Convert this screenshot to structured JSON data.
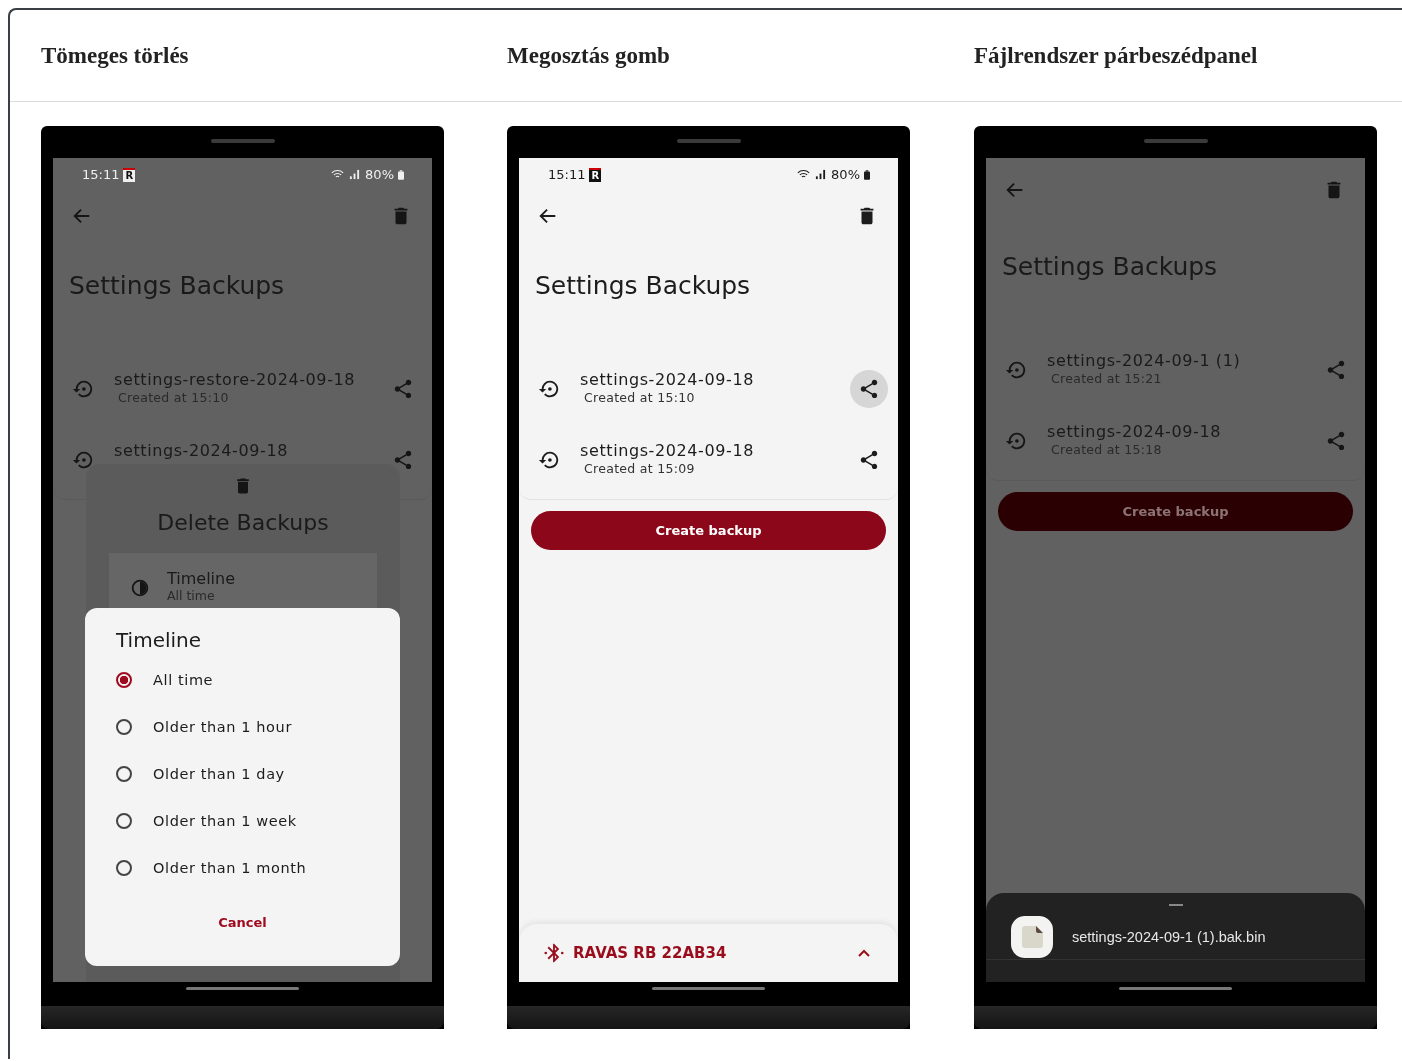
{
  "panels": [
    {
      "heading": "Tömeges törlés",
      "phone": {
        "dimmed": true,
        "status_bar": {
          "time": "15:11",
          "app_badge": "R",
          "battery": "80%"
        },
        "title": "Settings Backups",
        "backups": [
          {
            "name": "settings-restore-2024-09-18",
            "created": "Created at 15:10",
            "share_pressed": false
          },
          {
            "name": "settings-2024-09-18",
            "share_pressed": false
          }
        ],
        "delete_sheet": {
          "title": "Delete Backups",
          "option_label": "Timeline",
          "option_value": "All time"
        },
        "timeline_dialog": {
          "title": "Timeline",
          "options": [
            {
              "label": "All time",
              "selected": true
            },
            {
              "label": "Older than 1 hour",
              "selected": false
            },
            {
              "label": "Older than 1 day",
              "selected": false
            },
            {
              "label": "Older than 1 week",
              "selected": false
            },
            {
              "label": "Older than 1 month",
              "selected": false
            }
          ],
          "cancel": "Cancel"
        }
      }
    },
    {
      "heading": "Megosztás gomb",
      "phone": {
        "dimmed": false,
        "status_bar": {
          "time": "15:11",
          "app_badge": "R",
          "battery": "80%"
        },
        "title": "Settings Backups",
        "backups": [
          {
            "name": "settings-2024-09-18",
            "created": "Created at 15:10",
            "share_pressed": true
          },
          {
            "name": "settings-2024-09-18",
            "created": "Created at 15:09",
            "share_pressed": false
          }
        ],
        "create_button": "Create backup",
        "device_bar": {
          "name": "RAVAS RB 22AB34"
        }
      }
    },
    {
      "heading": "Fájlrendszer párbeszédpanel",
      "phone": {
        "dimmed": true,
        "title": "Settings Backups",
        "backups": [
          {
            "name": "settings-2024-09-1 (1)",
            "created": "Created at 15:21",
            "share_pressed": false
          },
          {
            "name": "settings-2024-09-18",
            "created": "Created at 15:18",
            "share_pressed": false
          }
        ],
        "create_button": "Create backup",
        "share_sheet": {
          "file_name": "settings-2024-09-1 (1).bak.bin"
        }
      }
    }
  ]
}
